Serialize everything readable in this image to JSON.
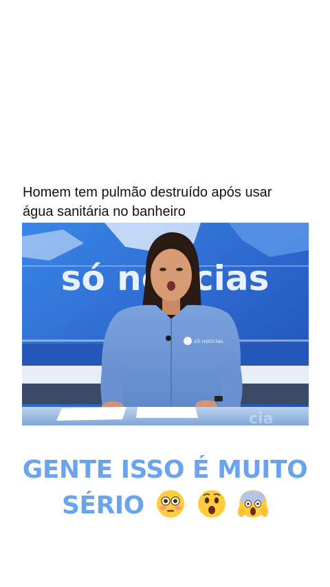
{
  "post": {
    "headline_line1": "Homem tem pulmão destruído após usar",
    "headline_line2": "água sanitária no banheiro",
    "video": {
      "backdrop_text": "só notícias",
      "shirt_logo_text": "só notícias"
    },
    "caption_line1": "GENTE ISSO É MUITO",
    "caption_line2": "SÉRIO",
    "caption_emojis": [
      "flushed-face-icon",
      "astonished-face-icon",
      "screaming-face-icon"
    ]
  },
  "colors": {
    "caption": "#6aa4f0",
    "headline": "#111111",
    "studio_blue": "#2d6fd6",
    "shirt_blue": "#6f98d6"
  }
}
